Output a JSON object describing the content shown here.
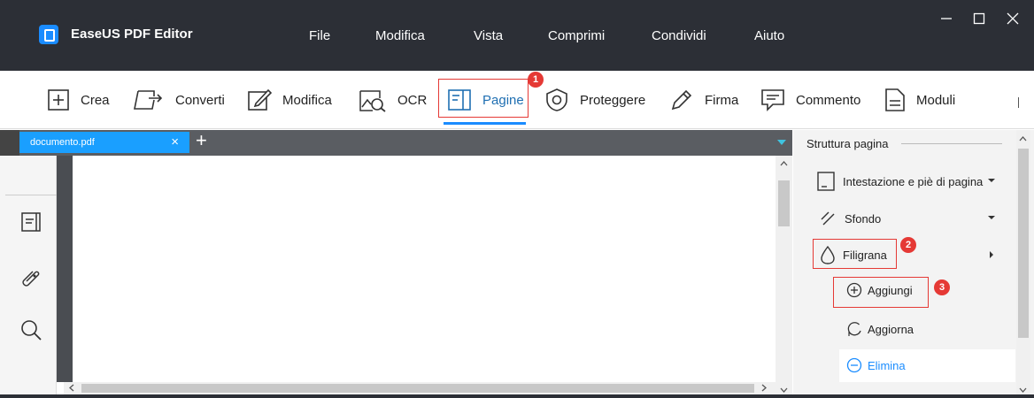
{
  "app": {
    "title": "EaseUS PDF Editor"
  },
  "menu": [
    "File",
    "Modifica",
    "Vista",
    "Comprimi",
    "Condividi",
    "Aiuto"
  ],
  "window_controls": {
    "minimize": "—",
    "maximize": "☐",
    "close": "✕"
  },
  "toolbar": {
    "items": [
      {
        "label": "Crea",
        "icon": "plus-square-icon"
      },
      {
        "label": "Converti",
        "icon": "convert-icon"
      },
      {
        "label": "Modifica",
        "icon": "edit-pen-icon"
      },
      {
        "label": "OCR",
        "icon": "ocr-icon"
      },
      {
        "label": "Pagine",
        "icon": "pages-icon",
        "active": true
      },
      {
        "label": "Proteggere",
        "icon": "shield-icon"
      },
      {
        "label": "Firma",
        "icon": "pen-icon"
      },
      {
        "label": "Commento",
        "icon": "comment-icon"
      },
      {
        "label": "Moduli",
        "icon": "form-icon"
      }
    ]
  },
  "tabs": {
    "document": "documento.pdf",
    "close": "×",
    "add": "+"
  },
  "panel": {
    "title": "Struttura pagina",
    "items": {
      "header_footer": "Intestazione e piè di pagina",
      "background": "Sfondo",
      "watermark": "Filigrana",
      "add": "Aggiungi",
      "update": "Aggiorna",
      "delete": "Elimina"
    }
  },
  "annotations": [
    "1",
    "2",
    "3"
  ],
  "colors": {
    "titlebar": "#2c2f36",
    "accent": "#1a9fff",
    "highlight": "#e53935",
    "delete_text": "#1a8cff"
  }
}
